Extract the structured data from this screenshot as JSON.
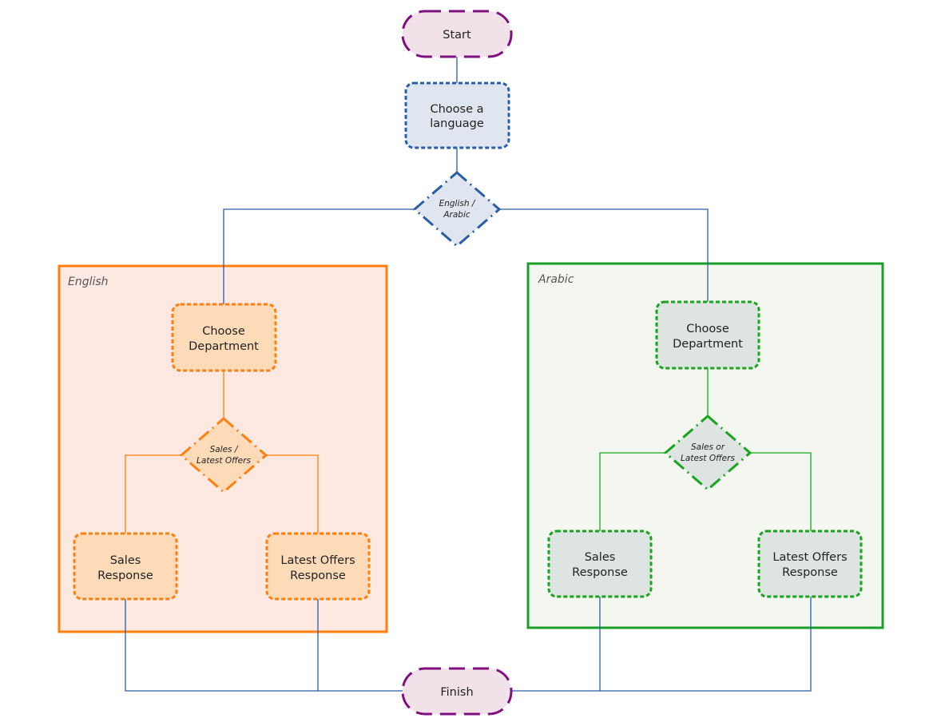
{
  "colors": {
    "terminal_stroke": "#800f80",
    "terminal_fill": "#f1e1e8",
    "blue_stroke": "#2a5ea8",
    "blue_fill": "#dfe6ef",
    "orange_stroke": "#ff7f0e",
    "orange_fill": "#fddbb9",
    "orange_group_fill": "#fde8e2",
    "green_stroke": "#17a51b",
    "green_fill": "#dde4e2",
    "green_group_fill": "#f4f7f0"
  },
  "nodes": {
    "start": "Start",
    "choose_language": [
      "Choose a",
      "language"
    ],
    "language_decision": [
      "English /",
      "Arabic"
    ],
    "finish": "Finish"
  },
  "groups": {
    "english": {
      "label": "English",
      "choose_department": [
        "Choose",
        "Department"
      ],
      "decision": [
        "Sales /",
        "Latest Offers"
      ],
      "sales": [
        "Sales",
        "Response"
      ],
      "offers": [
        "Latest Offers",
        "Response"
      ]
    },
    "arabic": {
      "label": "Arabic",
      "choose_department": [
        "Choose",
        "Department"
      ],
      "decision": [
        "Sales or",
        "Latest Offers"
      ],
      "sales": [
        "Sales",
        "Response"
      ],
      "offers": [
        "Latest Offers",
        "Response"
      ]
    }
  }
}
